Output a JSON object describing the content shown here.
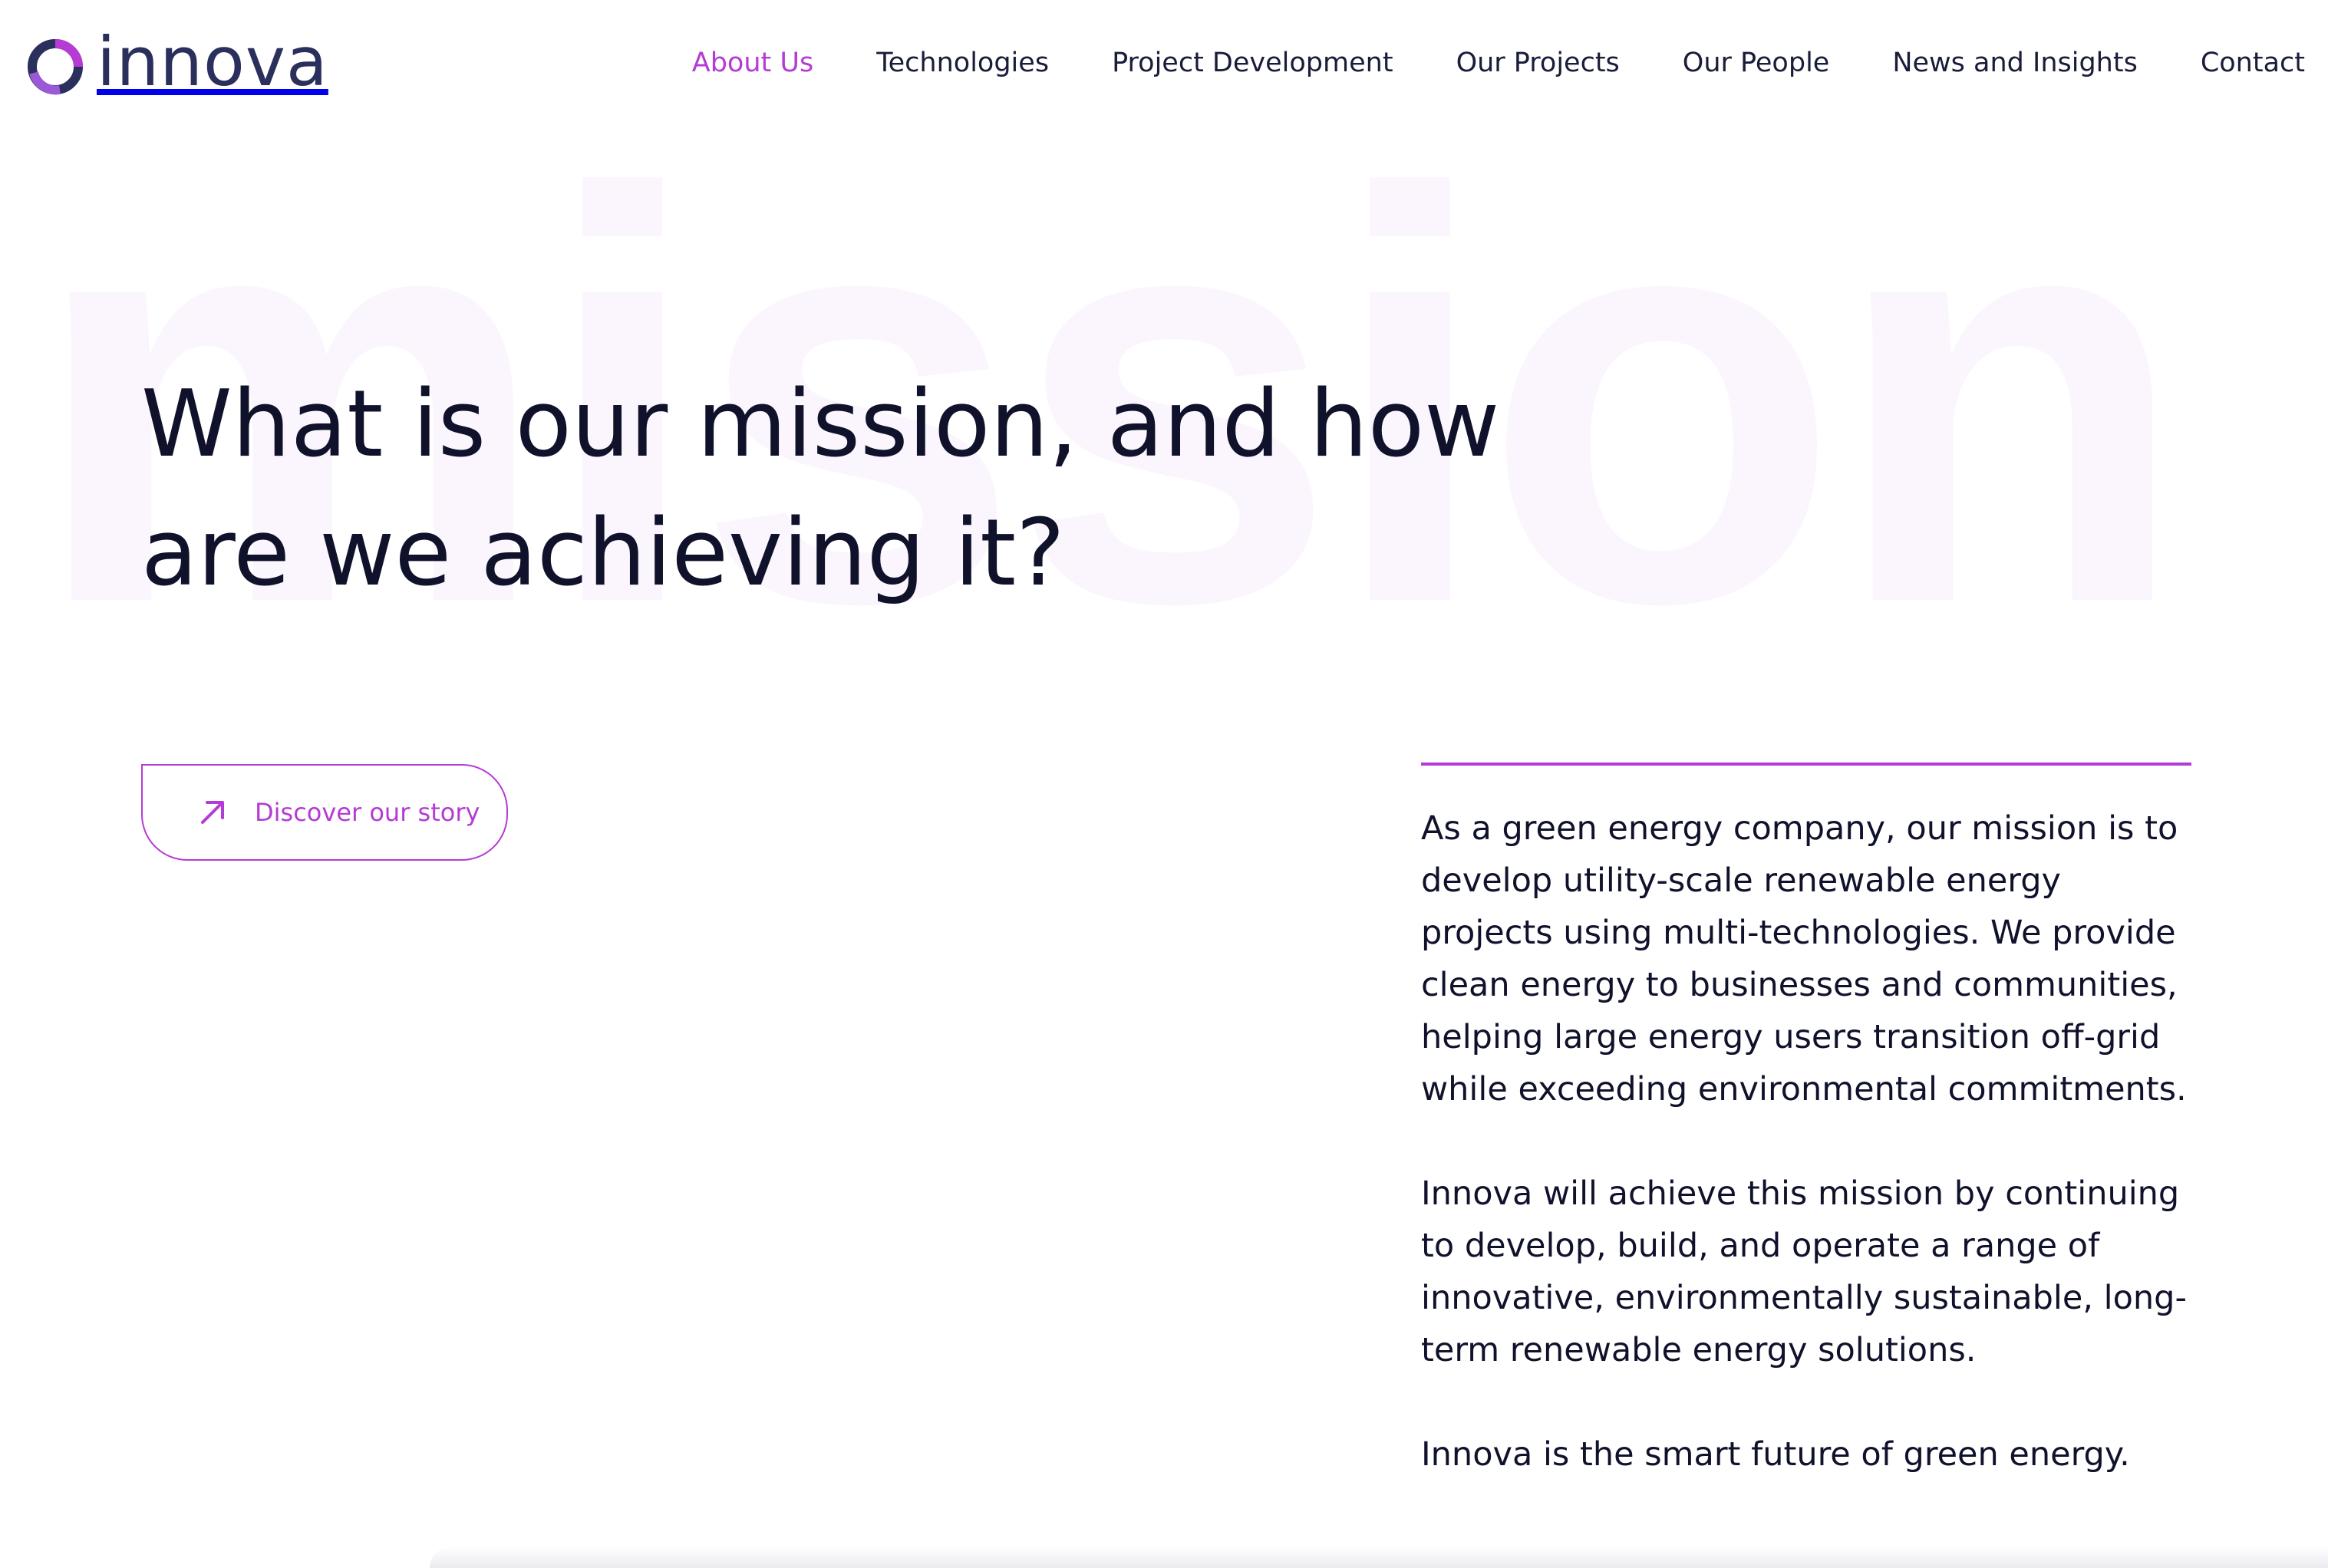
{
  "brand": {
    "logo_text": "innova",
    "accent_color": "#b53bd4",
    "dark_color": "#10122c",
    "logo_icon": "innova-ring-logo-icon"
  },
  "nav": {
    "items": [
      {
        "label": "About Us",
        "active": true
      },
      {
        "label": "Technologies",
        "active": false
      },
      {
        "label": "Project Development",
        "active": false
      },
      {
        "label": "Our Projects",
        "active": false
      },
      {
        "label": "Our People",
        "active": false
      },
      {
        "label": "News and Insights",
        "active": false
      },
      {
        "label": "Contact",
        "active": false
      }
    ]
  },
  "hero": {
    "watermark": "mission",
    "heading": "What is our mission, and how are we achieving it?"
  },
  "cta": {
    "label": "Discover our story",
    "icon": "arrow-up-right-icon"
  },
  "content": {
    "paragraphs": [
      "As a green energy company, our mission is to develop utility-scale renewable energy projects using multi-technologies. We provide clean energy to businesses and communities, helping large energy users transition off-grid while exceeding environmental commitments.",
      "Innova will achieve this mission by continuing to develop, build, and operate a range of innovative, environmentally sustainable, long-term renewable energy solutions.",
      "Innova is the smart future of green energy."
    ]
  }
}
